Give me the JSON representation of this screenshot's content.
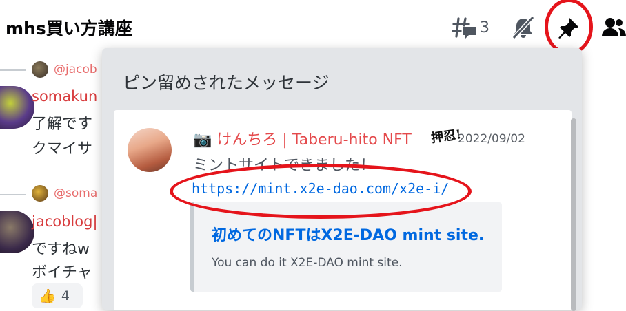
{
  "header": {
    "title": "mhs買い方講座",
    "thread_count": "3",
    "icons": [
      "threads-icon",
      "bell-muted-icon",
      "pin-icon",
      "members-icon"
    ]
  },
  "chat": {
    "messages": [
      {
        "reply_name": "@jacob",
        "author": "somakun",
        "lines": [
          "了解です",
          "クマイサ"
        ]
      },
      {
        "reply_name": "@soma",
        "author": "jacoblog|",
        "lines": [
          "ですねw",
          "ボイチャ"
        ],
        "reaction": {
          "emoji": "👍",
          "count": "4"
        }
      }
    ]
  },
  "pinned": {
    "title": "ピン留めされたメッセージ",
    "message": {
      "author": "けんちろ | Taberu-hito NFT",
      "author_emoji": "📷",
      "time": "2022/09/02",
      "text": "ミントサイトできました！",
      "link": "https://mint.x2e-dao.com/x2e-i/",
      "embed": {
        "title": "初めてのNFTはX2E-DAO mint site.",
        "description": "You can do it X2E-DAO mint site."
      }
    }
  },
  "colors": {
    "annotation_red": "#e5141b",
    "link": "#0068e0",
    "author_red": "#d83c3e"
  }
}
